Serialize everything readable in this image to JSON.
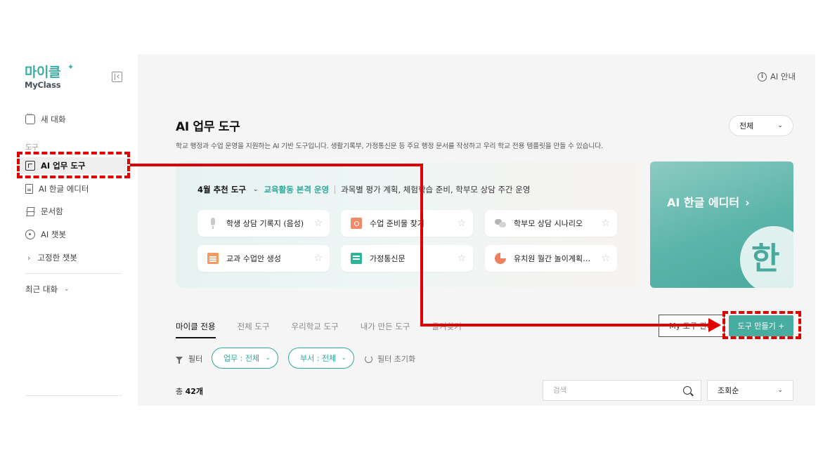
{
  "app": {
    "logo_main": "마이클",
    "logo_spark": "✦",
    "logo_sub": "MyClass"
  },
  "sidebar": {
    "new_chat": "새 대화",
    "section_tools": "도구",
    "items": [
      {
        "label": "AI 업무 도구",
        "icon": "box-icon",
        "active": true
      },
      {
        "label": "AI 한글 에디터",
        "icon": "document-icon"
      },
      {
        "label": "문서함",
        "icon": "stack-icon"
      },
      {
        "label": "AI 챗봇",
        "icon": "atom-icon"
      }
    ],
    "pinned_bots": "고정한 챗봇",
    "recent_chats": "최근 대화"
  },
  "header": {
    "ai_guide": "AI 안내"
  },
  "main": {
    "title": "AI 업무 도구",
    "description": "학교 행정과 수업 운영을 지원하는 AI 기반 도구입니다. 생활기록부, 가정통신문 등 주요 행정 문서를 작성하고 우리 학교 전용 템플릿을 만들 수 있습니다.",
    "category_select": "전체"
  },
  "recommend": {
    "month": "4월 추천 도구",
    "theme": "교육활동 본격 운영",
    "subtitle": "과목별 평가 계획, 체험학습 준비, 학부모 상담 주간 운영",
    "tools": [
      {
        "label": "학생 상담 기록지 (음성)",
        "icon": "mic-icon"
      },
      {
        "label": "수업 준비물 찾기",
        "icon": "folder-search-icon"
      },
      {
        "label": "학부모 상담 시나리오",
        "icon": "chat-bubbles-icon"
      },
      {
        "label": "교과 수업안 생성",
        "icon": "calendar-icon"
      },
      {
        "label": "가정통신문",
        "icon": "newsletter-icon"
      },
      {
        "label": "유치원 월간 놀이계획안 생성",
        "icon": "pie-icon"
      }
    ]
  },
  "editor_banner": {
    "title": "AI 한글 에디터",
    "arrow": "›",
    "logo_char": "한"
  },
  "tabs": [
    "마이클 전용",
    "전체 도구",
    "우리학교 도구",
    "내가 만든 도구",
    "즐겨찾기"
  ],
  "actions": {
    "my_tools": "My 도구 관리",
    "make_tool": "도구 만들기 +"
  },
  "filters": {
    "label": "필터",
    "task": "업무 : 전체",
    "dept": "부서 : 전체",
    "reset": "필터 초기화"
  },
  "list": {
    "total_prefix": "총 ",
    "total_count": "42개",
    "search_placeholder": "검색",
    "sort": "조회순"
  },
  "colors": {
    "accent": "#48ada0",
    "accent_text": "#2fa99b",
    "annotation": "#e00000"
  }
}
